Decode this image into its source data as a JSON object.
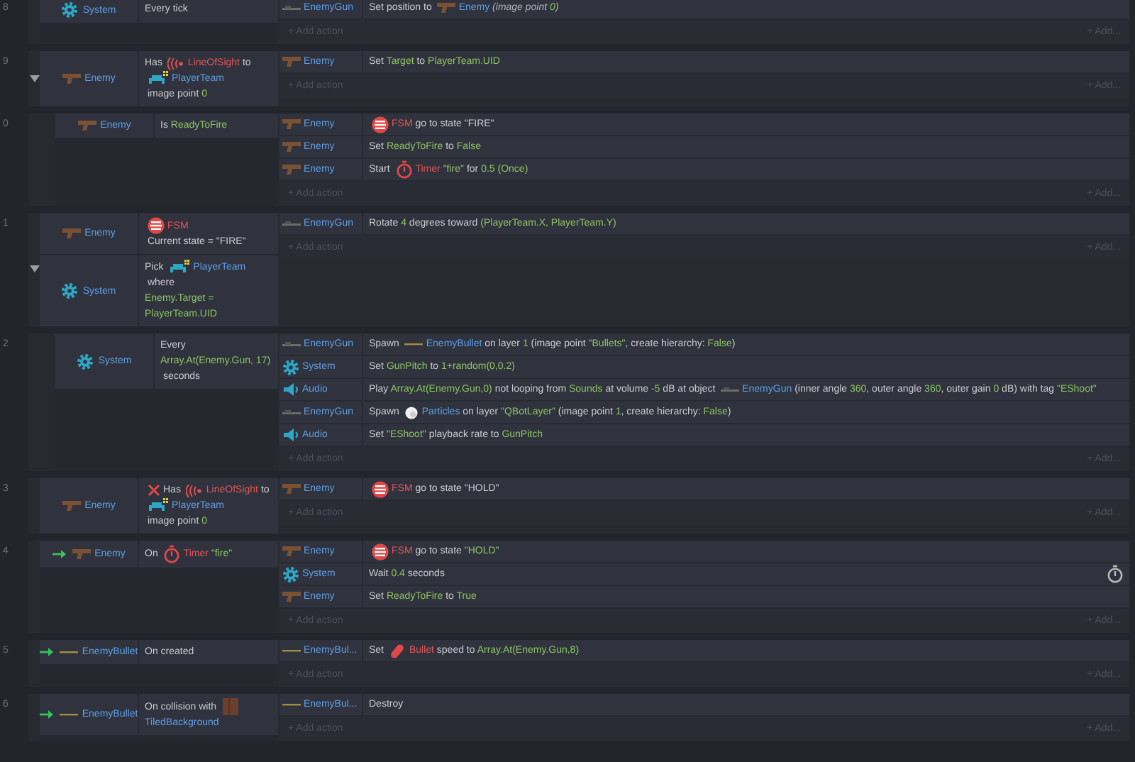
{
  "events": [
    {
      "number": "8",
      "conditions": [
        {
          "object": {
            "name": "System",
            "kind": "system"
          },
          "text": [
            {
              "kind": "text",
              "text": "Every tick"
            }
          ]
        }
      ],
      "actions": [
        {
          "object": {
            "name": "EnemyGun",
            "kind": "gun"
          },
          "text": [
            {
              "kind": "text",
              "text": "Set position to "
            },
            {
              "kind": "enemy",
              "text": "Enemy"
            },
            {
              "kind": "note",
              "text": " (image point "
            },
            {
              "kind": "note-value",
              "text": "0"
            },
            {
              "kind": "note",
              "text": ")"
            }
          ]
        }
      ],
      "add_action": "+ Add action",
      "add_more": "+ Add..."
    },
    {
      "number": "9",
      "expanded": true,
      "conditions": [
        {
          "object": {
            "name": "Enemy",
            "kind": "enemy"
          },
          "text": [
            {
              "kind": "text",
              "text": "Has "
            },
            {
              "kind": "los",
              "text": "LineOfSight"
            },
            {
              "kind": "text",
              "text": " to "
            },
            {
              "kind": "team",
              "text": "PlayerTeam"
            },
            {
              "kind": "text",
              "text": " image point "
            },
            {
              "kind": "value",
              "text": "0"
            }
          ]
        }
      ],
      "actions": [
        {
          "object": {
            "name": "Enemy",
            "kind": "enemy"
          },
          "text": [
            {
              "kind": "text",
              "text": "Set "
            },
            {
              "kind": "value",
              "text": "Target"
            },
            {
              "kind": "text",
              "text": " to "
            },
            {
              "kind": "value",
              "text": "PlayerTeam.UID"
            }
          ]
        }
      ],
      "add_action": "+ Add action",
      "add_more": "+ Add...",
      "children": [
        {
          "number": "0",
          "conditions": [
            {
              "object": {
                "name": "Enemy",
                "kind": "enemy"
              },
              "text": [
                {
                  "kind": "text",
                  "text": "Is "
                },
                {
                  "kind": "value",
                  "text": "ReadyToFire"
                }
              ]
            }
          ],
          "actions": [
            {
              "object": {
                "name": "Enemy",
                "kind": "enemy"
              },
              "text": [
                {
                  "kind": "fsm",
                  "text": "FSM"
                },
                {
                  "kind": "text",
                  "text": " go to state \"FIRE\""
                }
              ]
            },
            {
              "object": {
                "name": "Enemy",
                "kind": "enemy"
              },
              "text": [
                {
                  "kind": "text",
                  "text": "Set "
                },
                {
                  "kind": "value",
                  "text": "ReadyToFire"
                },
                {
                  "kind": "text",
                  "text": " to "
                },
                {
                  "kind": "value",
                  "text": "False"
                }
              ]
            },
            {
              "object": {
                "name": "Enemy",
                "kind": "enemy"
              },
              "text": [
                {
                  "kind": "text",
                  "text": "Start "
                },
                {
                  "kind": "timer",
                  "text": "Timer"
                },
                {
                  "kind": "value",
                  "text": " \"fire\""
                },
                {
                  "kind": "text",
                  "text": " for "
                },
                {
                  "kind": "value",
                  "text": "0.5 (Once)"
                }
              ]
            }
          ],
          "add_action": "+ Add action",
          "add_more": "+ Add..."
        }
      ]
    },
    {
      "number": "1",
      "expanded": true,
      "conditions": [
        {
          "object": {
            "name": "Enemy",
            "kind": "enemy"
          },
          "text": [
            {
              "kind": "fsm",
              "text": "FSM"
            },
            {
              "kind": "text",
              "text": " Current state = \"FIRE\""
            }
          ]
        },
        {
          "object": {
            "name": "System",
            "kind": "system"
          },
          "text": [
            {
              "kind": "text",
              "text": "Pick "
            },
            {
              "kind": "team",
              "text": "PlayerTeam"
            },
            {
              "kind": "text",
              "text": " where "
            },
            {
              "kind": "value",
              "text": "Enemy.Target = PlayerTeam.UID"
            }
          ]
        }
      ],
      "actions": [
        {
          "object": {
            "name": "EnemyGun",
            "kind": "gun"
          },
          "text": [
            {
              "kind": "text",
              "text": "Rotate "
            },
            {
              "kind": "value",
              "text": "4"
            },
            {
              "kind": "text",
              "text": " degrees toward "
            },
            {
              "kind": "value",
              "text": "(PlayerTeam.X, PlayerTeam.Y)"
            }
          ]
        }
      ],
      "add_action": "+ Add action",
      "add_more": "+ Add...",
      "children": [
        {
          "number": "2",
          "conditions": [
            {
              "object": {
                "name": "System",
                "kind": "system"
              },
              "text": [
                {
                  "kind": "text",
                  "text": "Every "
                },
                {
                  "kind": "value",
                  "text": "Array.At(Enemy.Gun, 17)"
                },
                {
                  "kind": "text",
                  "text": " seconds"
                }
              ]
            }
          ],
          "actions": [
            {
              "object": {
                "name": "EnemyGun",
                "kind": "gun"
              },
              "text": [
                {
                  "kind": "text",
                  "text": "Spawn "
                },
                {
                  "kind": "bullet",
                  "text": "EnemyBullet"
                },
                {
                  "kind": "text",
                  "text": " on layer "
                },
                {
                  "kind": "value",
                  "text": "1"
                },
                {
                  "kind": "text",
                  "text": " (image point "
                },
                {
                  "kind": "value",
                  "text": "\"Bullets\""
                },
                {
                  "kind": "text",
                  "text": ", create hierarchy: "
                },
                {
                  "kind": "value",
                  "text": "False"
                },
                {
                  "kind": "text",
                  "text": ")"
                }
              ]
            },
            {
              "object": {
                "name": "System",
                "kind": "system"
              },
              "text": [
                {
                  "kind": "text",
                  "text": "Set "
                },
                {
                  "kind": "value",
                  "text": "GunPitch"
                },
                {
                  "kind": "text",
                  "text": " to "
                },
                {
                  "kind": "value",
                  "text": "1+random(0,0.2)"
                }
              ]
            },
            {
              "object": {
                "name": "Audio",
                "kind": "audio"
              },
              "text": [
                {
                  "kind": "text",
                  "text": "Play "
                },
                {
                  "kind": "value",
                  "text": "Array.At(Enemy.Gun,0)"
                },
                {
                  "kind": "text",
                  "text": " not looping from "
                },
                {
                  "kind": "value",
                  "text": "Sounds"
                },
                {
                  "kind": "text",
                  "text": " at volume "
                },
                {
                  "kind": "value",
                  "text": "-5"
                },
                {
                  "kind": "text",
                  "text": " dB at object "
                },
                {
                  "kind": "gun",
                  "text": "EnemyGun"
                },
                {
                  "kind": "text",
                  "text": " (inner angle "
                },
                {
                  "kind": "value",
                  "text": "360"
                },
                {
                  "kind": "text",
                  "text": ", outer angle "
                },
                {
                  "kind": "value",
                  "text": "360"
                },
                {
                  "kind": "text",
                  "text": ", outer gain "
                },
                {
                  "kind": "value",
                  "text": "0"
                },
                {
                  "kind": "text",
                  "text": " dB) with tag "
                },
                {
                  "kind": "value",
                  "text": "\"EShoot\""
                }
              ]
            },
            {
              "object": {
                "name": "EnemyGun",
                "kind": "gun"
              },
              "text": [
                {
                  "kind": "text",
                  "text": "Spawn "
                },
                {
                  "kind": "particles",
                  "text": "Particles"
                },
                {
                  "kind": "text",
                  "text": " on layer "
                },
                {
                  "kind": "value",
                  "text": "\"QBotLayer\""
                },
                {
                  "kind": "text",
                  "text": " (image point "
                },
                {
                  "kind": "value",
                  "text": "1"
                },
                {
                  "kind": "text",
                  "text": ", create hierarchy: "
                },
                {
                  "kind": "value",
                  "text": "False"
                },
                {
                  "kind": "text",
                  "text": ")"
                }
              ]
            },
            {
              "object": {
                "name": "Audio",
                "kind": "audio"
              },
              "text": [
                {
                  "kind": "text",
                  "text": "Set "
                },
                {
                  "kind": "value",
                  "text": "\"EShoot\""
                },
                {
                  "kind": "text",
                  "text": " playback rate to "
                },
                {
                  "kind": "value",
                  "text": "GunPitch"
                }
              ]
            }
          ],
          "add_action": "+ Add action",
          "add_more": "+ Add..."
        }
      ]
    },
    {
      "number": "3",
      "conditions": [
        {
          "inverted": true,
          "object": {
            "name": "Enemy",
            "kind": "enemy"
          },
          "text": [
            {
              "kind": "text",
              "text": "Has "
            },
            {
              "kind": "los",
              "text": "LineOfSight"
            },
            {
              "kind": "text",
              "text": " to "
            },
            {
              "kind": "team",
              "text": "PlayerTeam"
            },
            {
              "kind": "text",
              "text": " image point "
            },
            {
              "kind": "value",
              "text": "0"
            }
          ]
        }
      ],
      "actions": [
        {
          "object": {
            "name": "Enemy",
            "kind": "enemy"
          },
          "text": [
            {
              "kind": "fsm",
              "text": "FSM"
            },
            {
              "kind": "text",
              "text": " go to state \"HOLD\""
            }
          ]
        }
      ],
      "add_action": "+ Add action",
      "add_more": "+ Add..."
    },
    {
      "number": "4",
      "trigger": true,
      "conditions": [
        {
          "object": {
            "name": "Enemy",
            "kind": "enemy"
          },
          "text": [
            {
              "kind": "text",
              "text": "On "
            },
            {
              "kind": "timer",
              "text": "Timer"
            },
            {
              "kind": "value",
              "text": " \"fire\""
            }
          ]
        }
      ],
      "actions": [
        {
          "object": {
            "name": "Enemy",
            "kind": "enemy"
          },
          "text": [
            {
              "kind": "fsm",
              "text": "FSM"
            },
            {
              "kind": "text",
              "text": " go to state "
            },
            {
              "kind": "value",
              "text": "\"HOLD\""
            }
          ]
        },
        {
          "async": true,
          "object": {
            "name": "System",
            "kind": "system"
          },
          "text": [
            {
              "kind": "text",
              "text": "Wait "
            },
            {
              "kind": "value",
              "text": "0.4"
            },
            {
              "kind": "text",
              "text": " seconds"
            }
          ]
        },
        {
          "object": {
            "name": "Enemy",
            "kind": "enemy"
          },
          "text": [
            {
              "kind": "text",
              "text": "Set "
            },
            {
              "kind": "value",
              "text": "ReadyToFire"
            },
            {
              "kind": "text",
              "text": " to "
            },
            {
              "kind": "value",
              "text": "True"
            }
          ]
        }
      ],
      "add_action": "+ Add action",
      "add_more": "+ Add..."
    },
    {
      "number": "5",
      "trigger": true,
      "conditions": [
        {
          "object": {
            "name": "EnemyBullet",
            "kind": "bullet"
          },
          "text": [
            {
              "kind": "text",
              "text": "On created"
            }
          ]
        }
      ],
      "actions": [
        {
          "object": {
            "name": "EnemyBul...",
            "kind": "bullet"
          },
          "text": [
            {
              "kind": "text",
              "text": "Set "
            },
            {
              "kind": "bullet-behavior",
              "text": "Bullet"
            },
            {
              "kind": "text",
              "text": " speed to "
            },
            {
              "kind": "value",
              "text": "Array.At(Enemy.Gun,8)"
            }
          ]
        }
      ],
      "add_action": "+ Add action",
      "add_more": "+ Add..."
    },
    {
      "number": "6",
      "trigger": true,
      "conditions": [
        {
          "object": {
            "name": "EnemyBullet",
            "kind": "bullet"
          },
          "text": [
            {
              "kind": "text",
              "text": "On collision with "
            },
            {
              "kind": "tiled",
              "text": "TiledBackground"
            }
          ]
        }
      ],
      "actions": [
        {
          "object": {
            "name": "EnemyBul...",
            "kind": "bullet"
          },
          "text": [
            {
              "kind": "text",
              "text": "Destroy"
            }
          ]
        }
      ],
      "add_action": "+ Add action",
      "add_more": "+ Add..."
    }
  ]
}
